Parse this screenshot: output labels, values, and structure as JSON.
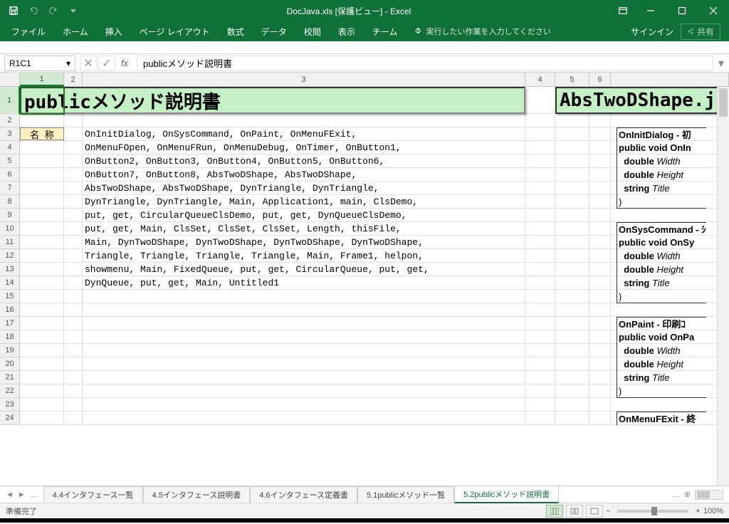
{
  "title": "DocJava.xls  [保護ビュー] - Excel",
  "ribbon": {
    "tabs": [
      "ファイル",
      "ホーム",
      "挿入",
      "ページ レイアウト",
      "数式",
      "データ",
      "校閲",
      "表示",
      "チーム"
    ],
    "tell_me": "実行したい作業を入力してください",
    "signin": "サインイン",
    "share": "共有"
  },
  "namebox": "R1C1",
  "formula": "publicメソッド説明書",
  "col_headers": [
    "1",
    "2",
    "3",
    "4",
    "5",
    "6"
  ],
  "doc": {
    "title_main": "publicメソッド説明書",
    "title_right": "AbsTwoDShape.j",
    "label_name": "名 称",
    "lines": [
      "OnInitDialog, OnSysCommand, OnPaint, OnMenuFExit,",
      "OnMenuFOpen, OnMenuFRun, OnMenuDebug, OnTimer, OnButton1,",
      "OnButton2, OnButton3, OnButton4, OnButton5, OnButton6,",
      "OnButton7, OnButton8, AbsTwoDShape, AbsTwoDShape,",
      "AbsTwoDShape, AbsTwoDShape, DynTriangle, DynTriangle,",
      "DynTriangle, DynTriangle, Main, Application1, main, ClsDemo,",
      "put, get, CircularQueueClsDemo, put, get, DynQueueClsDemo,",
      "put, get, Main, ClsSet, ClsSet, ClsSet, Length, thisFile,",
      "Main, DynTwoDShape, DynTwoDShape, DynTwoDShape, DynTwoDShape,",
      "Triangle, Triangle, Triangle, Triangle, Main, Frame1, helpon,",
      "showmenu, Main, FixedQueue, put, get, CircularQueue, put, get,",
      "DynQueue, put, get, Main, Untitled1"
    ],
    "right_blocks": [
      {
        "h": "OnInitDialog - 初",
        "sig": "public void OnIn",
        "p1w": "Width",
        "p2w": "Height",
        "p3w": "Title"
      },
      {
        "h": "OnSysCommand - ｼ",
        "sig": "public void OnSy",
        "p1w": "Width",
        "p2w": "Height",
        "p3w": "Title"
      },
      {
        "h": "OnPaint  - 印刷ｺ",
        "sig": "public void OnPa",
        "p1w": "Width",
        "p2w": "Height",
        "p3w": "Title"
      },
      {
        "h": "OnMenuFExit - 終"
      }
    ],
    "param_double": "double",
    "param_string": "string"
  },
  "sheets": {
    "tabs": [
      "4.4インタフェース一覧",
      "4.5インタフェース説明書",
      "4.6インタフェース定義書",
      "5.1publicメソッド一覧",
      "5.2publicメソッド説明書"
    ],
    "active": 4
  },
  "status": {
    "ready": "準備完了",
    "zoom": "100%"
  }
}
